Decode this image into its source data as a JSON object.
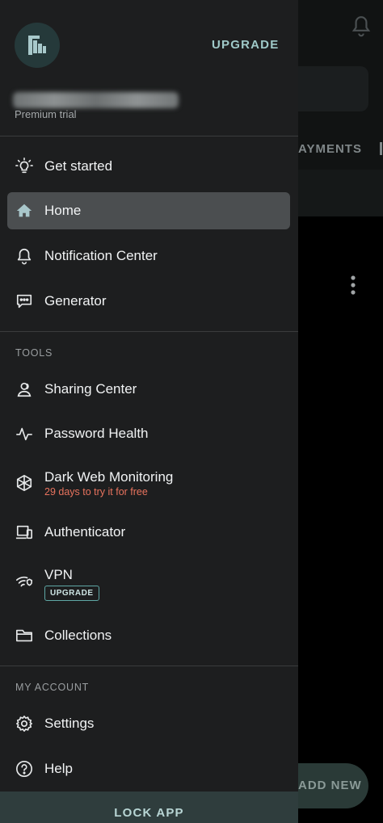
{
  "background": {
    "tab_partial": "AYMENTS",
    "fab_partial": "ADD NEW"
  },
  "drawer": {
    "upgrade_link": "UPGRADE",
    "account_plan": "Premium trial",
    "primary_items": [
      {
        "label": "Get started",
        "icon": "lightbulb-icon"
      },
      {
        "label": "Home",
        "icon": "home-icon",
        "active": true
      },
      {
        "label": "Notification Center",
        "icon": "bell-icon"
      },
      {
        "label": "Generator",
        "icon": "generator-icon"
      }
    ],
    "tools_section": "TOOLS",
    "tools_items": [
      {
        "label": "Sharing Center",
        "icon": "sharing-icon"
      },
      {
        "label": "Password Health",
        "icon": "pulse-icon"
      },
      {
        "label": "Dark Web Monitoring",
        "icon": "dark-web-icon",
        "subtitle": "29 days to try it for free"
      },
      {
        "label": "Authenticator",
        "icon": "authenticator-icon"
      },
      {
        "label": "VPN",
        "icon": "vpn-icon",
        "badge": "UPGRADE"
      },
      {
        "label": "Collections",
        "icon": "folder-icon"
      }
    ],
    "account_section": "MY ACCOUNT",
    "account_items": [
      {
        "label": "Settings",
        "icon": "gear-icon"
      },
      {
        "label": "Help",
        "icon": "help-icon"
      }
    ],
    "lock_button": "LOCK APP"
  },
  "colors": {
    "drawer_bg": "#1d1e1f",
    "accent": "#9fc9c8",
    "active_item_bg": "#4b4e50",
    "trial_text": "#e8735e"
  }
}
